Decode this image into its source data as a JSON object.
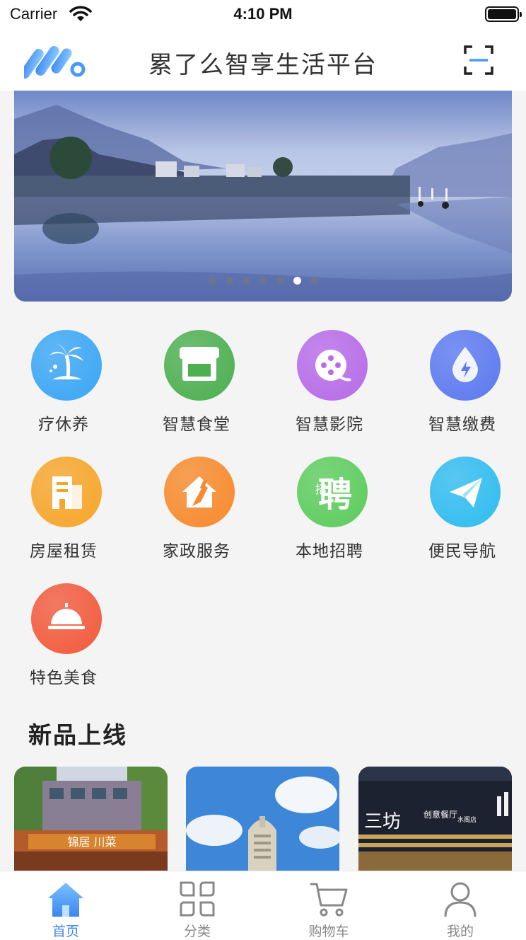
{
  "status_bar": {
    "carrier": "Carrier",
    "time": "4:10 PM"
  },
  "header": {
    "title": "累了么智享生活平台",
    "logo_icon": "brand-logo-icon",
    "scan_icon": "scan-icon"
  },
  "banner": {
    "slide_count": 7,
    "active_index": 5
  },
  "services": [
    {
      "label": "疗休养",
      "icon": "palm-island-icon",
      "color": "#3aa6f5"
    },
    {
      "label": "智慧食堂",
      "icon": "storefront-icon",
      "color": "#4caf50"
    },
    {
      "label": "智慧影院",
      "icon": "film-reel-icon",
      "color": "#b66be8"
    },
    {
      "label": "智慧缴费",
      "icon": "water-drop-bolt-icon",
      "color": "#5b79f0"
    },
    {
      "label": "房屋租赁",
      "icon": "building-icon",
      "color": "#f7a52a"
    },
    {
      "label": "家政服务",
      "icon": "house-broom-icon",
      "color": "#f78a2c"
    },
    {
      "label": "本地招聘",
      "icon": "recruit-icon",
      "icon_text": "聘",
      "icon_text_small": "招",
      "color": "#5ccc5c"
    },
    {
      "label": "便民导航",
      "icon": "paper-plane-icon",
      "color": "#2fbcf0"
    },
    {
      "label": "特色美食",
      "icon": "cloche-icon",
      "color": "#f25a3c"
    }
  ],
  "new_products": {
    "title": "新品上线",
    "items": [
      {
        "sign_text": "锦居 川菜"
      },
      {
        "sign_text": ""
      },
      {
        "sign_text": "三坊",
        "sign_text_2": "创意餐厅",
        "sign_text_3": "水阁店"
      }
    ]
  },
  "tab_bar": {
    "tabs": [
      {
        "label": "首页",
        "icon": "home-icon",
        "active": true
      },
      {
        "label": "分类",
        "icon": "category-icon",
        "active": false
      },
      {
        "label": "购物车",
        "icon": "cart-icon",
        "active": false
      },
      {
        "label": "我的",
        "icon": "profile-icon",
        "active": false
      }
    ]
  },
  "colors": {
    "accent": "#3d86f0",
    "inactive": "#888888",
    "background": "#f4f4f5"
  }
}
